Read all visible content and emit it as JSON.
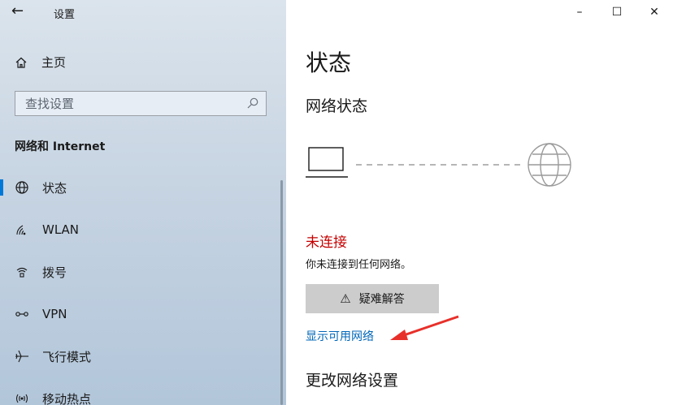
{
  "window": {
    "back_icon": "back-arrow-icon",
    "title": "设置",
    "minimize": "–",
    "maximize": "☐",
    "close": "✕"
  },
  "sidebar": {
    "home_label": "主页",
    "search_placeholder": "查找设置",
    "section_title": "网络和 Internet",
    "items": [
      {
        "label": "状态",
        "icon": "globe-icon",
        "selected": true
      },
      {
        "label": "WLAN",
        "icon": "wifi-icon",
        "selected": false
      },
      {
        "label": "拨号",
        "icon": "dialup-icon",
        "selected": false
      },
      {
        "label": "VPN",
        "icon": "vpn-icon",
        "selected": false
      },
      {
        "label": "飞行模式",
        "icon": "airplane-icon",
        "selected": false
      },
      {
        "label": "移动热点",
        "icon": "hotspot-icon",
        "selected": false
      }
    ]
  },
  "main": {
    "page_title": "状态",
    "network_status_title": "网络状态",
    "connection_status": "未连接",
    "connection_desc": "你未连接到任何网络。",
    "troubleshoot_label": "疑难解答",
    "troubleshoot_icon": "⚠",
    "show_networks_link": "显示可用网络",
    "change_settings_title": "更改网络设置"
  },
  "colors": {
    "accent": "#0078d7",
    "link": "#0067b8",
    "error": "#c40000",
    "annotation_arrow": "#e8302a"
  }
}
